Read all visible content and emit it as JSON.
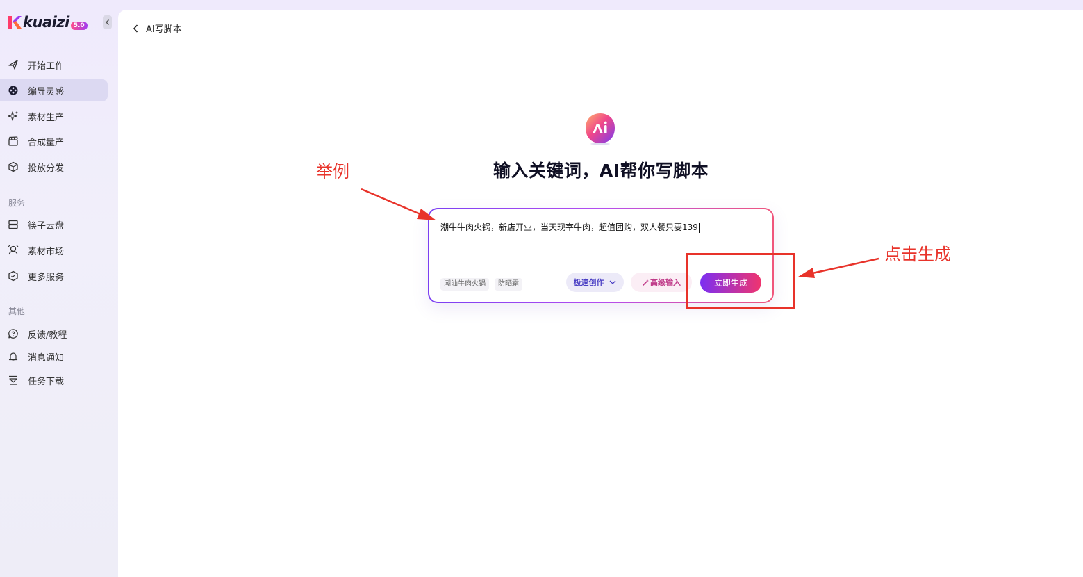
{
  "app": {
    "logo_text": "kuaizi",
    "logo_version": "5.0"
  },
  "sidebar": {
    "items": [
      {
        "label": "开始工作",
        "icon": "rocket-icon"
      },
      {
        "label": "编导灵感",
        "icon": "film-reel-icon",
        "active": true
      },
      {
        "label": "素材生产",
        "icon": "sparkle-icon"
      },
      {
        "label": "合成量产",
        "icon": "clapperboard-icon"
      },
      {
        "label": "投放分发",
        "icon": "cube-icon"
      }
    ],
    "section_services": "服务",
    "services": [
      {
        "label": "筷子云盘",
        "icon": "storage-icon"
      },
      {
        "label": "素材市场",
        "icon": "market-icon"
      },
      {
        "label": "更多服务",
        "icon": "more-services-icon"
      }
    ],
    "section_other": "其他",
    "other": [
      {
        "label": "反馈/教程",
        "icon": "question-bubble-icon"
      },
      {
        "label": "消息通知",
        "icon": "bell-icon"
      },
      {
        "label": "任务下载",
        "icon": "download-icon"
      }
    ]
  },
  "header": {
    "back_label": "AI写脚本"
  },
  "hero": {
    "title": "输入关键词，AI帮你写脚本"
  },
  "prompt": {
    "value": "潮牛牛肉火锅，新店开业，当天现宰牛肉，超值团购，双人餐只要139",
    "chips": [
      "潮汕牛肉火锅",
      "防晒霜"
    ],
    "mode_label": "极速创作",
    "advanced_label": "高级输入",
    "generate_label": "立即生成"
  },
  "annotations": {
    "example_label": "举例",
    "click_label": "点击生成",
    "color": "#e8332a"
  }
}
